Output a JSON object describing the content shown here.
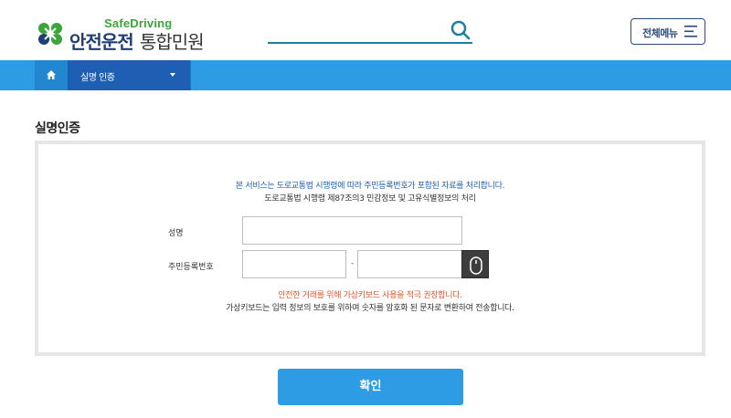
{
  "header": {
    "logo_en": "SafeDriving",
    "logo_ko_bold": "안전운전",
    "logo_ko": "통합민원",
    "search_placeholder": "",
    "menu_label": "전체메뉴"
  },
  "nav": {
    "dropdown_label": "실명 인증"
  },
  "page": {
    "title": "실명인증"
  },
  "form": {
    "notice_line1": "본 서비스는 도로교통법 시행령에 따라 주민등록번호가 포함된 자료를 처리합니다.",
    "notice_line2": "도로교통법 시행령 제87조의3 민감정보 및 고유식별정보의 처리",
    "name_label": "성명",
    "name_value": "",
    "rrn_label": "주민등록번호",
    "rrn_front_value": "",
    "rrn_separator": "-",
    "rrn_back_value": "",
    "warning_line1": "안전한 거래를 위해 가상키보드 사용을 적극 권장합니다.",
    "warning_line2": "가상키보드는 입력 정보의 보호를 위하여 숫자를 암호화 된 문자로 변환하여 전송합니다.",
    "confirm_label": "확인"
  },
  "colors": {
    "primary": "#2e9be5",
    "nav_active": "#1f5fb3",
    "warning": "#e0552e",
    "logo_green": "#3aa63a",
    "logo_navy": "#1f3e73"
  },
  "icons": {
    "logo": "clover-logo-icon",
    "search": "search-icon",
    "menu": "hamburger-icon",
    "home": "home-icon",
    "virtual_keyboard": "mouse-icon"
  }
}
